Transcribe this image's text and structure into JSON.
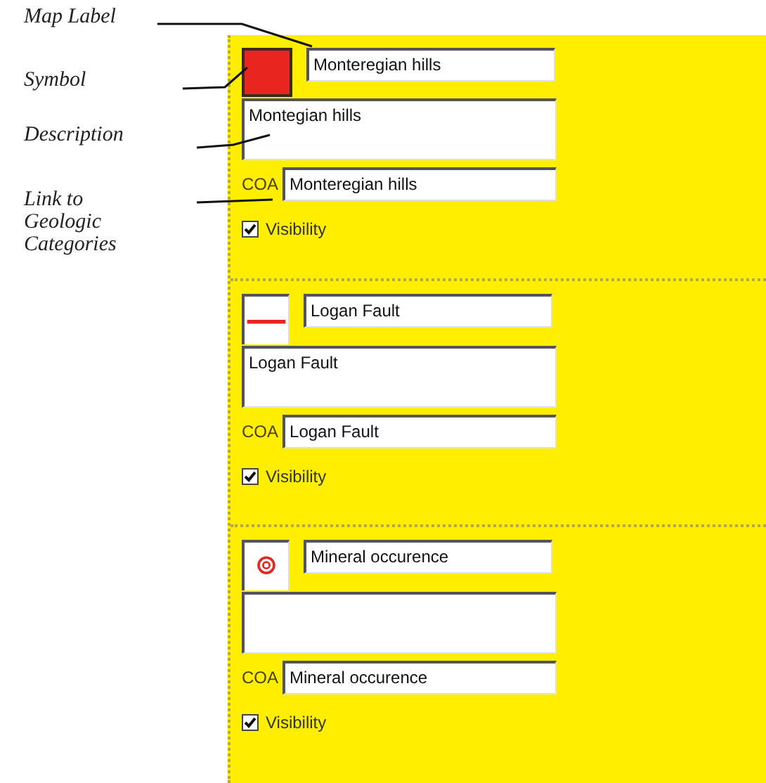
{
  "annotations": [
    {
      "text": "Map Label"
    },
    {
      "text": "Symbol"
    },
    {
      "text": "Description"
    },
    {
      "text": "Link to Geologic Categories"
    }
  ],
  "entries": [
    {
      "symbol": {
        "kind": "fill"
      },
      "map_label": "Monteregian hills",
      "description": "Montegian hills",
      "coa_label": "COA",
      "coa": "Monteregian hills",
      "visibility_label": "Visibility",
      "visible": true
    },
    {
      "symbol": {
        "kind": "line"
      },
      "map_label": "Logan Fault",
      "description": "Logan Fault",
      "coa_label": "COA",
      "coa": "Logan Fault",
      "visibility_label": "Visibility",
      "visible": true
    },
    {
      "symbol": {
        "kind": "point"
      },
      "map_label": "Mineral occurence",
      "coa_label": "COA",
      "coa": "Mineral occurence",
      "visibility_label": "Visibility",
      "visible": true
    }
  ]
}
